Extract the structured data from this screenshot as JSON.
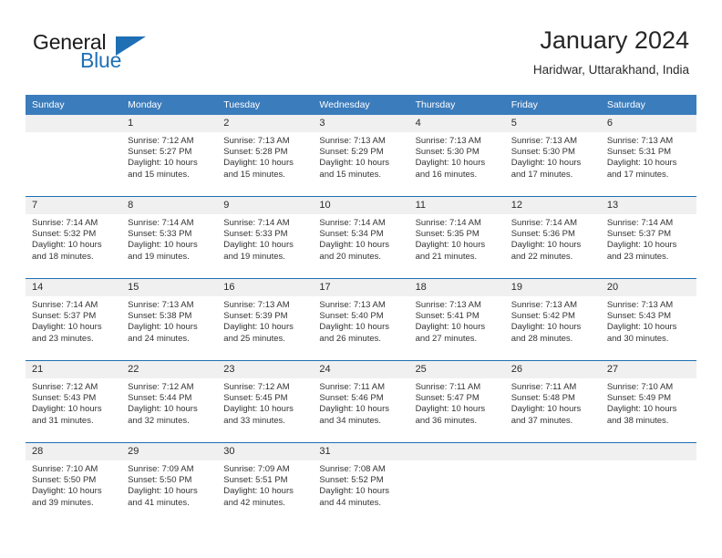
{
  "logo": {
    "word_one": "General",
    "word_two": "Blue",
    "triangle": "blue-triangle-icon"
  },
  "header": {
    "title": "January 2024",
    "location": "Haridwar, Uttarakhand, India"
  },
  "colors": {
    "header_blue": "#3b7cbc",
    "rule_blue": "#1f6fb5",
    "daynum_band": "#f0f0f0",
    "text": "#333333"
  },
  "weekday_headers": [
    "Sunday",
    "Monday",
    "Tuesday",
    "Wednesday",
    "Thursday",
    "Friday",
    "Saturday"
  ],
  "weeks": [
    [
      {
        "day": "",
        "sunrise": "",
        "sunset": "",
        "daylight_line1": "",
        "daylight_line2": ""
      },
      {
        "day": "1",
        "sunrise": "Sunrise: 7:12 AM",
        "sunset": "Sunset: 5:27 PM",
        "daylight_line1": "Daylight: 10 hours",
        "daylight_line2": "and 15 minutes."
      },
      {
        "day": "2",
        "sunrise": "Sunrise: 7:13 AM",
        "sunset": "Sunset: 5:28 PM",
        "daylight_line1": "Daylight: 10 hours",
        "daylight_line2": "and 15 minutes."
      },
      {
        "day": "3",
        "sunrise": "Sunrise: 7:13 AM",
        "sunset": "Sunset: 5:29 PM",
        "daylight_line1": "Daylight: 10 hours",
        "daylight_line2": "and 15 minutes."
      },
      {
        "day": "4",
        "sunrise": "Sunrise: 7:13 AM",
        "sunset": "Sunset: 5:30 PM",
        "daylight_line1": "Daylight: 10 hours",
        "daylight_line2": "and 16 minutes."
      },
      {
        "day": "5",
        "sunrise": "Sunrise: 7:13 AM",
        "sunset": "Sunset: 5:30 PM",
        "daylight_line1": "Daylight: 10 hours",
        "daylight_line2": "and 17 minutes."
      },
      {
        "day": "6",
        "sunrise": "Sunrise: 7:13 AM",
        "sunset": "Sunset: 5:31 PM",
        "daylight_line1": "Daylight: 10 hours",
        "daylight_line2": "and 17 minutes."
      }
    ],
    [
      {
        "day": "7",
        "sunrise": "Sunrise: 7:14 AM",
        "sunset": "Sunset: 5:32 PM",
        "daylight_line1": "Daylight: 10 hours",
        "daylight_line2": "and 18 minutes."
      },
      {
        "day": "8",
        "sunrise": "Sunrise: 7:14 AM",
        "sunset": "Sunset: 5:33 PM",
        "daylight_line1": "Daylight: 10 hours",
        "daylight_line2": "and 19 minutes."
      },
      {
        "day": "9",
        "sunrise": "Sunrise: 7:14 AM",
        "sunset": "Sunset: 5:33 PM",
        "daylight_line1": "Daylight: 10 hours",
        "daylight_line2": "and 19 minutes."
      },
      {
        "day": "10",
        "sunrise": "Sunrise: 7:14 AM",
        "sunset": "Sunset: 5:34 PM",
        "daylight_line1": "Daylight: 10 hours",
        "daylight_line2": "and 20 minutes."
      },
      {
        "day": "11",
        "sunrise": "Sunrise: 7:14 AM",
        "sunset": "Sunset: 5:35 PM",
        "daylight_line1": "Daylight: 10 hours",
        "daylight_line2": "and 21 minutes."
      },
      {
        "day": "12",
        "sunrise": "Sunrise: 7:14 AM",
        "sunset": "Sunset: 5:36 PM",
        "daylight_line1": "Daylight: 10 hours",
        "daylight_line2": "and 22 minutes."
      },
      {
        "day": "13",
        "sunrise": "Sunrise: 7:14 AM",
        "sunset": "Sunset: 5:37 PM",
        "daylight_line1": "Daylight: 10 hours",
        "daylight_line2": "and 23 minutes."
      }
    ],
    [
      {
        "day": "14",
        "sunrise": "Sunrise: 7:14 AM",
        "sunset": "Sunset: 5:37 PM",
        "daylight_line1": "Daylight: 10 hours",
        "daylight_line2": "and 23 minutes."
      },
      {
        "day": "15",
        "sunrise": "Sunrise: 7:13 AM",
        "sunset": "Sunset: 5:38 PM",
        "daylight_line1": "Daylight: 10 hours",
        "daylight_line2": "and 24 minutes."
      },
      {
        "day": "16",
        "sunrise": "Sunrise: 7:13 AM",
        "sunset": "Sunset: 5:39 PM",
        "daylight_line1": "Daylight: 10 hours",
        "daylight_line2": "and 25 minutes."
      },
      {
        "day": "17",
        "sunrise": "Sunrise: 7:13 AM",
        "sunset": "Sunset: 5:40 PM",
        "daylight_line1": "Daylight: 10 hours",
        "daylight_line2": "and 26 minutes."
      },
      {
        "day": "18",
        "sunrise": "Sunrise: 7:13 AM",
        "sunset": "Sunset: 5:41 PM",
        "daylight_line1": "Daylight: 10 hours",
        "daylight_line2": "and 27 minutes."
      },
      {
        "day": "19",
        "sunrise": "Sunrise: 7:13 AM",
        "sunset": "Sunset: 5:42 PM",
        "daylight_line1": "Daylight: 10 hours",
        "daylight_line2": "and 28 minutes."
      },
      {
        "day": "20",
        "sunrise": "Sunrise: 7:13 AM",
        "sunset": "Sunset: 5:43 PM",
        "daylight_line1": "Daylight: 10 hours",
        "daylight_line2": "and 30 minutes."
      }
    ],
    [
      {
        "day": "21",
        "sunrise": "Sunrise: 7:12 AM",
        "sunset": "Sunset: 5:43 PM",
        "daylight_line1": "Daylight: 10 hours",
        "daylight_line2": "and 31 minutes."
      },
      {
        "day": "22",
        "sunrise": "Sunrise: 7:12 AM",
        "sunset": "Sunset: 5:44 PM",
        "daylight_line1": "Daylight: 10 hours",
        "daylight_line2": "and 32 minutes."
      },
      {
        "day": "23",
        "sunrise": "Sunrise: 7:12 AM",
        "sunset": "Sunset: 5:45 PM",
        "daylight_line1": "Daylight: 10 hours",
        "daylight_line2": "and 33 minutes."
      },
      {
        "day": "24",
        "sunrise": "Sunrise: 7:11 AM",
        "sunset": "Sunset: 5:46 PM",
        "daylight_line1": "Daylight: 10 hours",
        "daylight_line2": "and 34 minutes."
      },
      {
        "day": "25",
        "sunrise": "Sunrise: 7:11 AM",
        "sunset": "Sunset: 5:47 PM",
        "daylight_line1": "Daylight: 10 hours",
        "daylight_line2": "and 36 minutes."
      },
      {
        "day": "26",
        "sunrise": "Sunrise: 7:11 AM",
        "sunset": "Sunset: 5:48 PM",
        "daylight_line1": "Daylight: 10 hours",
        "daylight_line2": "and 37 minutes."
      },
      {
        "day": "27",
        "sunrise": "Sunrise: 7:10 AM",
        "sunset": "Sunset: 5:49 PM",
        "daylight_line1": "Daylight: 10 hours",
        "daylight_line2": "and 38 minutes."
      }
    ],
    [
      {
        "day": "28",
        "sunrise": "Sunrise: 7:10 AM",
        "sunset": "Sunset: 5:50 PM",
        "daylight_line1": "Daylight: 10 hours",
        "daylight_line2": "and 39 minutes."
      },
      {
        "day": "29",
        "sunrise": "Sunrise: 7:09 AM",
        "sunset": "Sunset: 5:50 PM",
        "daylight_line1": "Daylight: 10 hours",
        "daylight_line2": "and 41 minutes."
      },
      {
        "day": "30",
        "sunrise": "Sunrise: 7:09 AM",
        "sunset": "Sunset: 5:51 PM",
        "daylight_line1": "Daylight: 10 hours",
        "daylight_line2": "and 42 minutes."
      },
      {
        "day": "31",
        "sunrise": "Sunrise: 7:08 AM",
        "sunset": "Sunset: 5:52 PM",
        "daylight_line1": "Daylight: 10 hours",
        "daylight_line2": "and 44 minutes."
      },
      {
        "day": "",
        "sunrise": "",
        "sunset": "",
        "daylight_line1": "",
        "daylight_line2": ""
      },
      {
        "day": "",
        "sunrise": "",
        "sunset": "",
        "daylight_line1": "",
        "daylight_line2": ""
      },
      {
        "day": "",
        "sunrise": "",
        "sunset": "",
        "daylight_line1": "",
        "daylight_line2": ""
      }
    ]
  ]
}
